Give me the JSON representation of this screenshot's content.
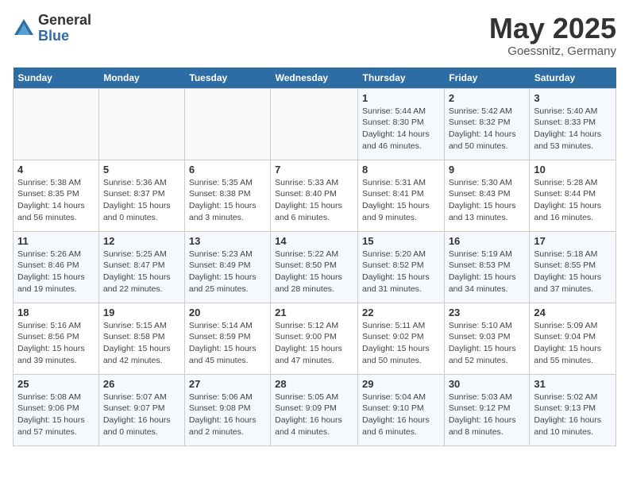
{
  "header": {
    "logo_general": "General",
    "logo_blue": "Blue",
    "month_title": "May 2025",
    "location": "Goessnitz, Germany"
  },
  "days_of_week": [
    "Sunday",
    "Monday",
    "Tuesday",
    "Wednesday",
    "Thursday",
    "Friday",
    "Saturday"
  ],
  "weeks": [
    [
      {
        "day": "",
        "info": ""
      },
      {
        "day": "",
        "info": ""
      },
      {
        "day": "",
        "info": ""
      },
      {
        "day": "",
        "info": ""
      },
      {
        "day": "1",
        "info": "Sunrise: 5:44 AM\nSunset: 8:30 PM\nDaylight: 14 hours and 46 minutes."
      },
      {
        "day": "2",
        "info": "Sunrise: 5:42 AM\nSunset: 8:32 PM\nDaylight: 14 hours and 50 minutes."
      },
      {
        "day": "3",
        "info": "Sunrise: 5:40 AM\nSunset: 8:33 PM\nDaylight: 14 hours and 53 minutes."
      }
    ],
    [
      {
        "day": "4",
        "info": "Sunrise: 5:38 AM\nSunset: 8:35 PM\nDaylight: 14 hours and 56 minutes."
      },
      {
        "day": "5",
        "info": "Sunrise: 5:36 AM\nSunset: 8:37 PM\nDaylight: 15 hours and 0 minutes."
      },
      {
        "day": "6",
        "info": "Sunrise: 5:35 AM\nSunset: 8:38 PM\nDaylight: 15 hours and 3 minutes."
      },
      {
        "day": "7",
        "info": "Sunrise: 5:33 AM\nSunset: 8:40 PM\nDaylight: 15 hours and 6 minutes."
      },
      {
        "day": "8",
        "info": "Sunrise: 5:31 AM\nSunset: 8:41 PM\nDaylight: 15 hours and 9 minutes."
      },
      {
        "day": "9",
        "info": "Sunrise: 5:30 AM\nSunset: 8:43 PM\nDaylight: 15 hours and 13 minutes."
      },
      {
        "day": "10",
        "info": "Sunrise: 5:28 AM\nSunset: 8:44 PM\nDaylight: 15 hours and 16 minutes."
      }
    ],
    [
      {
        "day": "11",
        "info": "Sunrise: 5:26 AM\nSunset: 8:46 PM\nDaylight: 15 hours and 19 minutes."
      },
      {
        "day": "12",
        "info": "Sunrise: 5:25 AM\nSunset: 8:47 PM\nDaylight: 15 hours and 22 minutes."
      },
      {
        "day": "13",
        "info": "Sunrise: 5:23 AM\nSunset: 8:49 PM\nDaylight: 15 hours and 25 minutes."
      },
      {
        "day": "14",
        "info": "Sunrise: 5:22 AM\nSunset: 8:50 PM\nDaylight: 15 hours and 28 minutes."
      },
      {
        "day": "15",
        "info": "Sunrise: 5:20 AM\nSunset: 8:52 PM\nDaylight: 15 hours and 31 minutes."
      },
      {
        "day": "16",
        "info": "Sunrise: 5:19 AM\nSunset: 8:53 PM\nDaylight: 15 hours and 34 minutes."
      },
      {
        "day": "17",
        "info": "Sunrise: 5:18 AM\nSunset: 8:55 PM\nDaylight: 15 hours and 37 minutes."
      }
    ],
    [
      {
        "day": "18",
        "info": "Sunrise: 5:16 AM\nSunset: 8:56 PM\nDaylight: 15 hours and 39 minutes."
      },
      {
        "day": "19",
        "info": "Sunrise: 5:15 AM\nSunset: 8:58 PM\nDaylight: 15 hours and 42 minutes."
      },
      {
        "day": "20",
        "info": "Sunrise: 5:14 AM\nSunset: 8:59 PM\nDaylight: 15 hours and 45 minutes."
      },
      {
        "day": "21",
        "info": "Sunrise: 5:12 AM\nSunset: 9:00 PM\nDaylight: 15 hours and 47 minutes."
      },
      {
        "day": "22",
        "info": "Sunrise: 5:11 AM\nSunset: 9:02 PM\nDaylight: 15 hours and 50 minutes."
      },
      {
        "day": "23",
        "info": "Sunrise: 5:10 AM\nSunset: 9:03 PM\nDaylight: 15 hours and 52 minutes."
      },
      {
        "day": "24",
        "info": "Sunrise: 5:09 AM\nSunset: 9:04 PM\nDaylight: 15 hours and 55 minutes."
      }
    ],
    [
      {
        "day": "25",
        "info": "Sunrise: 5:08 AM\nSunset: 9:06 PM\nDaylight: 15 hours and 57 minutes."
      },
      {
        "day": "26",
        "info": "Sunrise: 5:07 AM\nSunset: 9:07 PM\nDaylight: 16 hours and 0 minutes."
      },
      {
        "day": "27",
        "info": "Sunrise: 5:06 AM\nSunset: 9:08 PM\nDaylight: 16 hours and 2 minutes."
      },
      {
        "day": "28",
        "info": "Sunrise: 5:05 AM\nSunset: 9:09 PM\nDaylight: 16 hours and 4 minutes."
      },
      {
        "day": "29",
        "info": "Sunrise: 5:04 AM\nSunset: 9:10 PM\nDaylight: 16 hours and 6 minutes."
      },
      {
        "day": "30",
        "info": "Sunrise: 5:03 AM\nSunset: 9:12 PM\nDaylight: 16 hours and 8 minutes."
      },
      {
        "day": "31",
        "info": "Sunrise: 5:02 AM\nSunset: 9:13 PM\nDaylight: 16 hours and 10 minutes."
      }
    ]
  ]
}
